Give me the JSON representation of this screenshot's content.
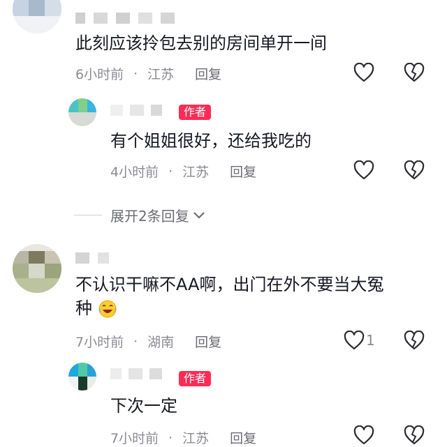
{
  "comments": [
    {
      "text": "此刻应该拎包去别的房间单开一间",
      "time": "6小时前",
      "location": "江苏",
      "reply_label": "回复",
      "replies": [
        {
          "author_tag": "作者",
          "text": "有个姐姐很好，还给我吃的",
          "time": "4小时前",
          "location": "江苏",
          "reply_label": "回复"
        }
      ],
      "expand_label": "展开2条回复"
    },
    {
      "text_line1": "不认识干嘛不AA啊，出门在外不要当大冤",
      "text_line2": "种",
      "time": "7小时前",
      "location": "湖南",
      "reply_label": "回复",
      "like_count": "1",
      "replies": [
        {
          "author_tag": "作者",
          "text": "下次一定",
          "time": "7小时前",
          "location": "江苏",
          "reply_label": "回复"
        }
      ]
    }
  ],
  "colors": {
    "author_tag_bg": "#fe2c55",
    "meta_text": "#8a8b91"
  },
  "icons": {
    "like": "heart-outline-icon",
    "dislike": "broken-heart-icon",
    "emoji": "laughing-crying-emoji"
  }
}
